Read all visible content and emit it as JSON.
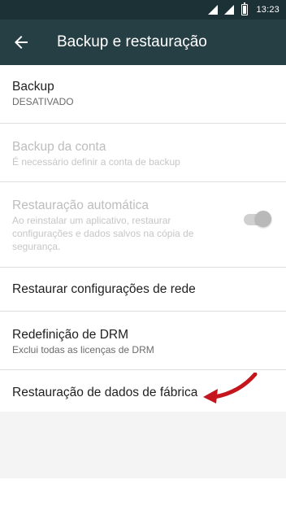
{
  "status_bar": {
    "time": "13:23"
  },
  "app_bar": {
    "title": "Backup e restauração"
  },
  "settings": {
    "backup": {
      "title": "Backup",
      "summary": "DESATIVADO"
    },
    "account": {
      "title": "Backup da conta",
      "summary": "É necessário definir a conta de backup"
    },
    "auto_restore": {
      "title": "Restauração automática",
      "summary": "Ao reinstalar um aplicativo, restaurar configurações e dados salvos na cópia de segurança.",
      "toggle_on": true
    },
    "network_reset": {
      "title": "Restaurar configurações de rede"
    },
    "drm_reset": {
      "title": "Redefinição de DRM",
      "summary": "Exclui todas as licenças de DRM"
    },
    "factory_reset": {
      "title": "Restauração de dados de fábrica"
    }
  },
  "colors": {
    "status_bar": "#1c3136",
    "app_bar": "#263f44",
    "annotation_arrow": "#c4161c"
  }
}
